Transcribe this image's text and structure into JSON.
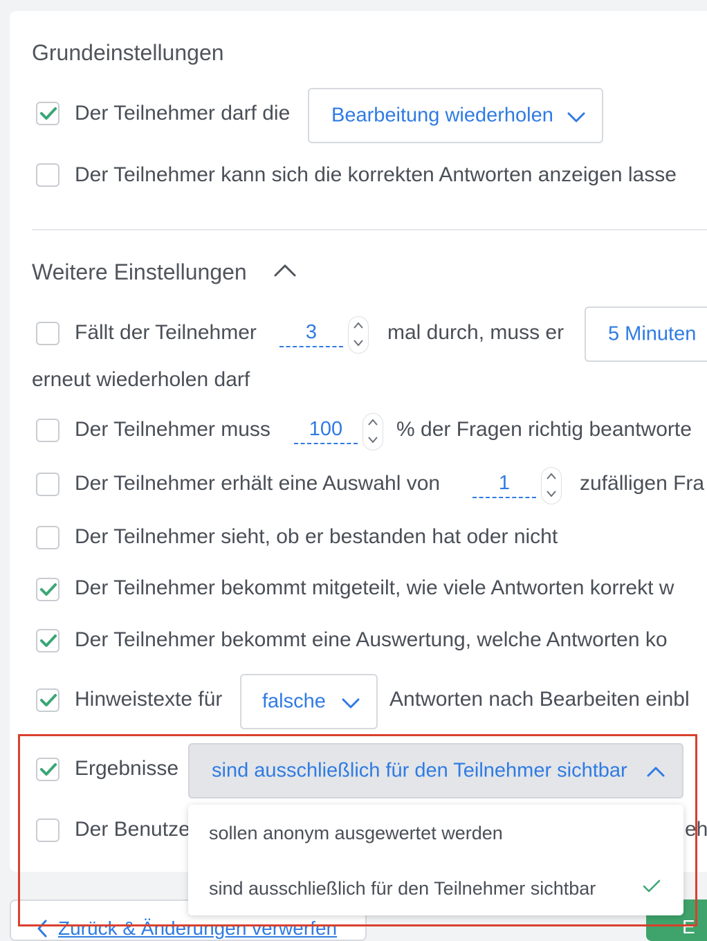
{
  "basic": {
    "title": "Grundeinstellungen",
    "row1": {
      "checked": true,
      "label": "Der Teilnehmer darf die",
      "select": "Bearbeitung wiederholen"
    },
    "row2": {
      "checked": false,
      "label": "Der Teilnehmer kann sich die korrekten Antworten anzeigen lasse"
    }
  },
  "more": {
    "title": "Weitere Einstellungen",
    "fail": {
      "checked": false,
      "label_before": "Fällt der Teilnehmer",
      "count": "3",
      "label_after": "mal durch, muss er",
      "select": "5 Minuten",
      "continuation": "erneut wiederholen darf"
    },
    "pass": {
      "checked": false,
      "label_before": "Der Teilnehmer muss",
      "value": "100",
      "label_after": "% der Fragen richtig beantworte"
    },
    "random": {
      "checked": false,
      "label_before": "Der Teilnehmer erhält eine Auswahl von",
      "value": "1",
      "label_after": "zufälligen Fra"
    },
    "sees_pass": {
      "checked": false,
      "label": "Der Teilnehmer sieht, ob er bestanden hat oder nicht"
    },
    "count_correct": {
      "checked": true,
      "label": "Der Teilnehmer bekommt mitgeteilt, wie viele Antworten korrekt w"
    },
    "evaluation": {
      "checked": true,
      "label": "Der Teilnehmer bekommt eine Auswertung, welche Antworten ko"
    },
    "hints": {
      "checked": true,
      "label_before": "Hinweistexte für",
      "select": "falsche",
      "label_after": "Antworten nach Bearbeiten einbl"
    },
    "results": {
      "checked": true,
      "label": "Ergebnisse",
      "select": "sind ausschließlich für den Teilnehmer sichtbar",
      "options": [
        "sollen anonym ausgewertet werden",
        "sind ausschließlich für den Teilnehmer sichtbar"
      ],
      "selected_index": 1
    },
    "user": {
      "checked": false,
      "label": "Der Benutze",
      "tail": "eh"
    }
  },
  "footer": {
    "back_label": "Zurück & Änderungen verwerfen",
    "save_label": "E"
  },
  "colors": {
    "accent": "#2f7be3",
    "check": "#3aa676",
    "highlight": "#d9402e",
    "save": "#3fa46c"
  }
}
